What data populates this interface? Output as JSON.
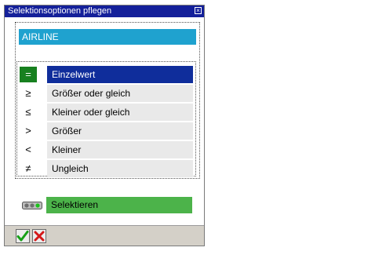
{
  "window": {
    "title": "Selektionsoptionen pflegen"
  },
  "field": {
    "name": "AIRLINE"
  },
  "options": [
    {
      "symbol": "=",
      "label": "Einzelwert",
      "selected": true
    },
    {
      "symbol": "≥",
      "label": "Größer oder gleich",
      "selected": false
    },
    {
      "symbol": "≤",
      "label": "Kleiner oder gleich",
      "selected": false
    },
    {
      "symbol": ">",
      "label": "Größer",
      "selected": false
    },
    {
      "symbol": "<",
      "label": "Kleiner",
      "selected": false
    },
    {
      "symbol": "≠",
      "label": "Ungleich",
      "selected": false
    }
  ],
  "select_button": {
    "label": "Selektieren"
  },
  "icons": {
    "close": "close-icon",
    "ok": "checkmark-icon",
    "cancel": "cancel-icon",
    "select": "traffic-light-icon"
  },
  "colors": {
    "titlebar": "#14209a",
    "field": "#1fa2cf",
    "selected": "#0f2d9b",
    "selected_symbol": "#17801f",
    "select_button": "#4cb34a"
  }
}
